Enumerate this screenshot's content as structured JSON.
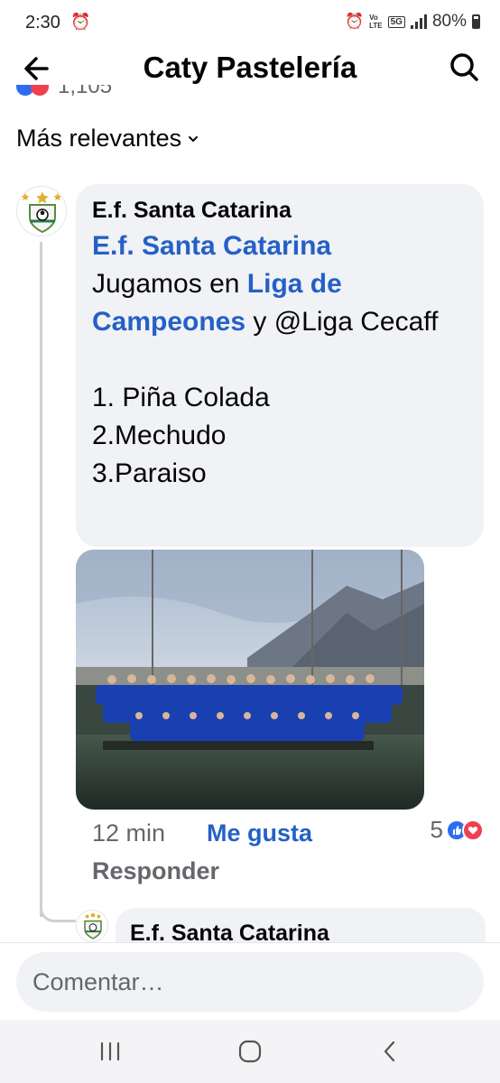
{
  "status_bar": {
    "time": "2:30",
    "battery": "80%",
    "network": "5G",
    "volte_top": "Vo",
    "volte_bottom": "LTE"
  },
  "header": {
    "title": "Caty Pastelería"
  },
  "post": {
    "reaction_count_partial": "1,105"
  },
  "sort": {
    "label": "Más relevantes"
  },
  "comment": {
    "author": "E.f. Santa Catarina",
    "mention_page": "E.f. Santa Catarina",
    "text_before": "Jugamos en ",
    "mention_liga": "Liga de Campeones",
    "text_middle": " y @Liga Cecaff",
    "list": [
      "1. Piña Colada",
      "2.Mechudo",
      "3.Paraiso"
    ],
    "photo_icon": "team-photo",
    "time": "12 min",
    "like_label": "Me gusta",
    "reply_label": "Responder",
    "reaction_count": "5"
  },
  "reply": {
    "author": "E.f. Santa Catarina"
  },
  "composer": {
    "placeholder": "Comentar…"
  },
  "colors": {
    "link_blue": "#2560c6",
    "bubble_gray": "#f0f2f5",
    "meta_gray": "#65676b",
    "like_blue": "#2d6ef0",
    "love_red": "#f04050"
  }
}
